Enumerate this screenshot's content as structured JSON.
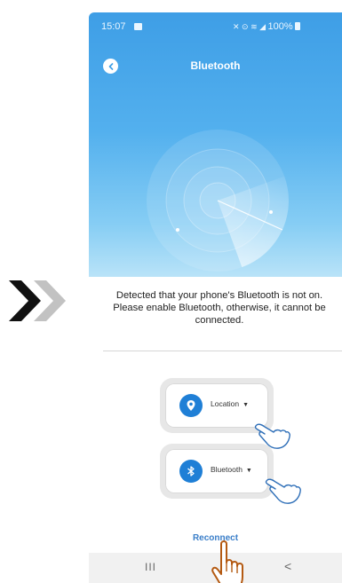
{
  "status_bar": {
    "time": "15:07",
    "right_text": "100%"
  },
  "header": {
    "title": "Bluetooth"
  },
  "message": {
    "line1": "Detected that your phone's Bluetooth is not on.",
    "line2": "Please enable Bluetooth, otherwise, it cannot be",
    "line3": "connected."
  },
  "toggles": {
    "location_label": "Location",
    "bluetooth_label": "Bluetooth",
    "caret": "▼"
  },
  "actions": {
    "reconnect_label": "Reconnect"
  },
  "nav": {
    "recents": "III",
    "back": "<"
  },
  "colors": {
    "header_blue": "#3e9ee6",
    "accent_blue": "#1f7fd6",
    "link_blue": "#3a7ec9"
  },
  "icons": [
    "double-chevron-icon",
    "back-arrow-icon",
    "radar-icon",
    "location-pin-icon",
    "bluetooth-icon",
    "pointing-hand-icon"
  ]
}
